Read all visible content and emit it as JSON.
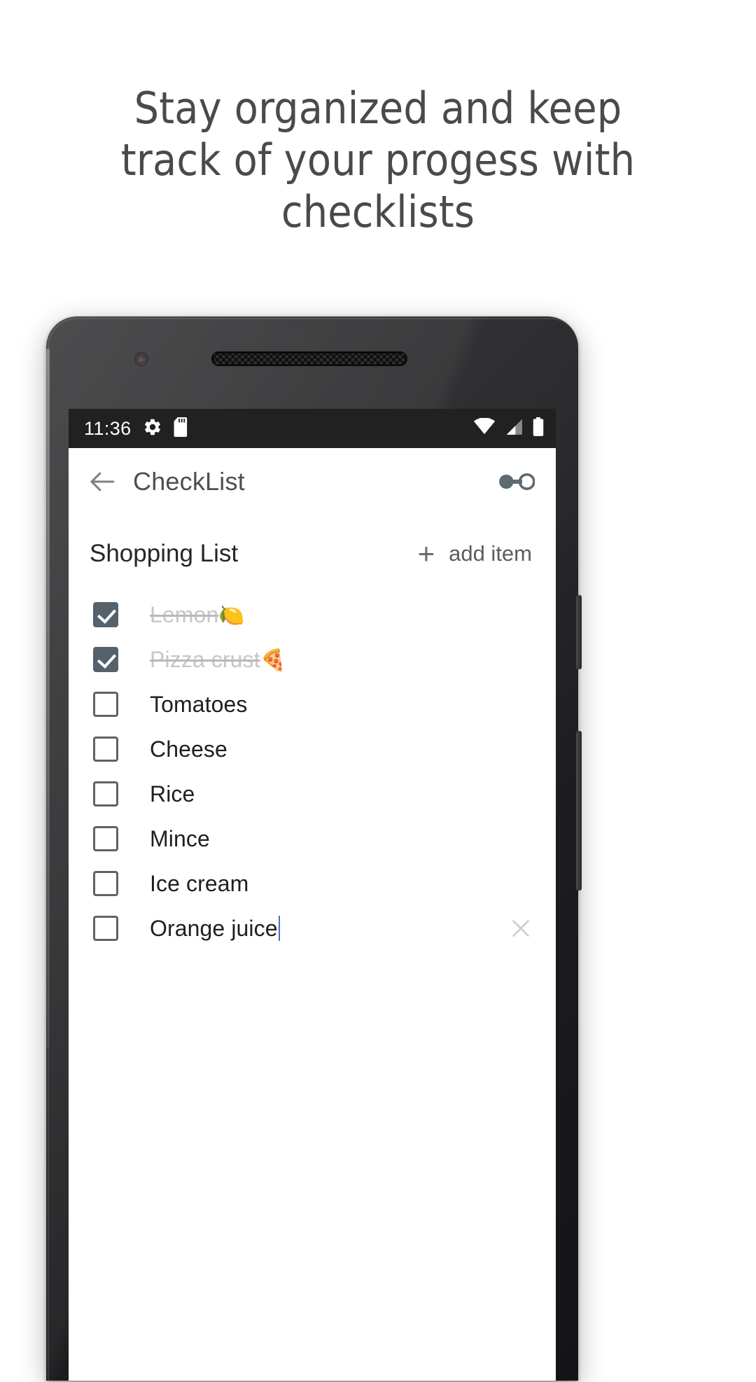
{
  "promo": {
    "headline_lines": [
      "Stay organized and keep",
      "track of your progess with",
      "checklists"
    ],
    "headline_color": "#4a4a4a",
    "background_color": "#ffffff"
  },
  "phone": {
    "statusbar": {
      "clock": "11:36",
      "left_icons": [
        "gear-icon",
        "sd-card-icon"
      ],
      "right_icons": [
        "wifi-icon",
        "cell-signal-icon",
        "battery-icon"
      ],
      "background_color": "#212121",
      "foreground_color": "#ffffff"
    },
    "toolbar": {
      "back_icon": "back-arrow-icon",
      "title": "CheckList",
      "overflow_icon": "overflow-glasses-icon",
      "title_color": "#4f4f4f"
    },
    "list": {
      "title": "Shopping List",
      "add_item": {
        "plus": "+",
        "label": "add item"
      },
      "accent_color": "#55626c",
      "items": [
        {
          "label": "Lemon",
          "emoji": "🍋",
          "checked": true,
          "editing": false
        },
        {
          "label": "Pizza crust",
          "emoji": "🍕",
          "checked": true,
          "editing": false
        },
        {
          "label": "Tomatoes",
          "emoji": "",
          "checked": false,
          "editing": false
        },
        {
          "label": "Cheese",
          "emoji": "",
          "checked": false,
          "editing": false
        },
        {
          "label": "Rice",
          "emoji": "",
          "checked": false,
          "editing": false
        },
        {
          "label": "Mince",
          "emoji": "",
          "checked": false,
          "editing": false
        },
        {
          "label": "Ice cream",
          "emoji": "",
          "checked": false,
          "editing": false
        },
        {
          "label": "Orange juice",
          "emoji": "",
          "checked": false,
          "editing": true
        }
      ]
    }
  }
}
